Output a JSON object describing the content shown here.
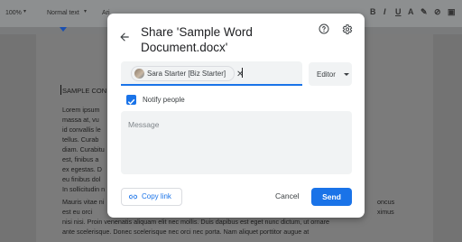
{
  "toolbar": {
    "zoom": "100%",
    "style": "Normal text",
    "font": "Ari",
    "icons": [
      "bold-icon",
      "italic-icon",
      "underline-icon",
      "text-color-icon",
      "highlight-icon",
      "link-icon",
      "comment-icon",
      "image-icon",
      "align-icon",
      "line-spacing-icon",
      "checklist-icon",
      "bullets-icon",
      "numbered-list-icon",
      "indent-icon",
      "more-icon"
    ]
  },
  "document": {
    "heading": "SAMPLE CON",
    "lines_left": [
      "Lorem ipsum",
      "massa at, vu",
      "id convallis le",
      "tellus. Curab",
      "diam. Curabitu",
      "est, finibus a",
      "ex egestas. D",
      "eu finibus dol",
      "In sollicitudin n",
      "",
      "Mauris vitae ni",
      "est eu orci"
    ],
    "lines_right": [
      "",
      "",
      "",
      "",
      "",
      "",
      "",
      "",
      "",
      "",
      "",
      "",
      "oncus",
      "ximus"
    ],
    "bottom_lines": [
      "Donec et nisi dictum felis sollicitudin congue. Sed rhoncus",
      "nisi nisi. Proin venenatis aliquam elit nec mollis. Duis dapibus est eget nunc dictum, ut ornare",
      "ante scelerisque. Donec scelerisque nec orci nec porta. Nam aliquet porttitor augue at"
    ]
  },
  "dialog": {
    "title": "Share 'Sample Word Document.docx'",
    "help_icon": "help-circle-icon",
    "settings_icon": "gear-icon",
    "back_icon": "back-arrow-icon",
    "recipient_chip": "Sara Starter [Biz Starter]",
    "role": "Editor",
    "notify_label": "Notify people",
    "notify_checked": true,
    "message_placeholder": "Message",
    "copy_link_label": "Copy link",
    "cancel_label": "Cancel",
    "send_label": "Send",
    "accent_color": "#1a73e8"
  }
}
